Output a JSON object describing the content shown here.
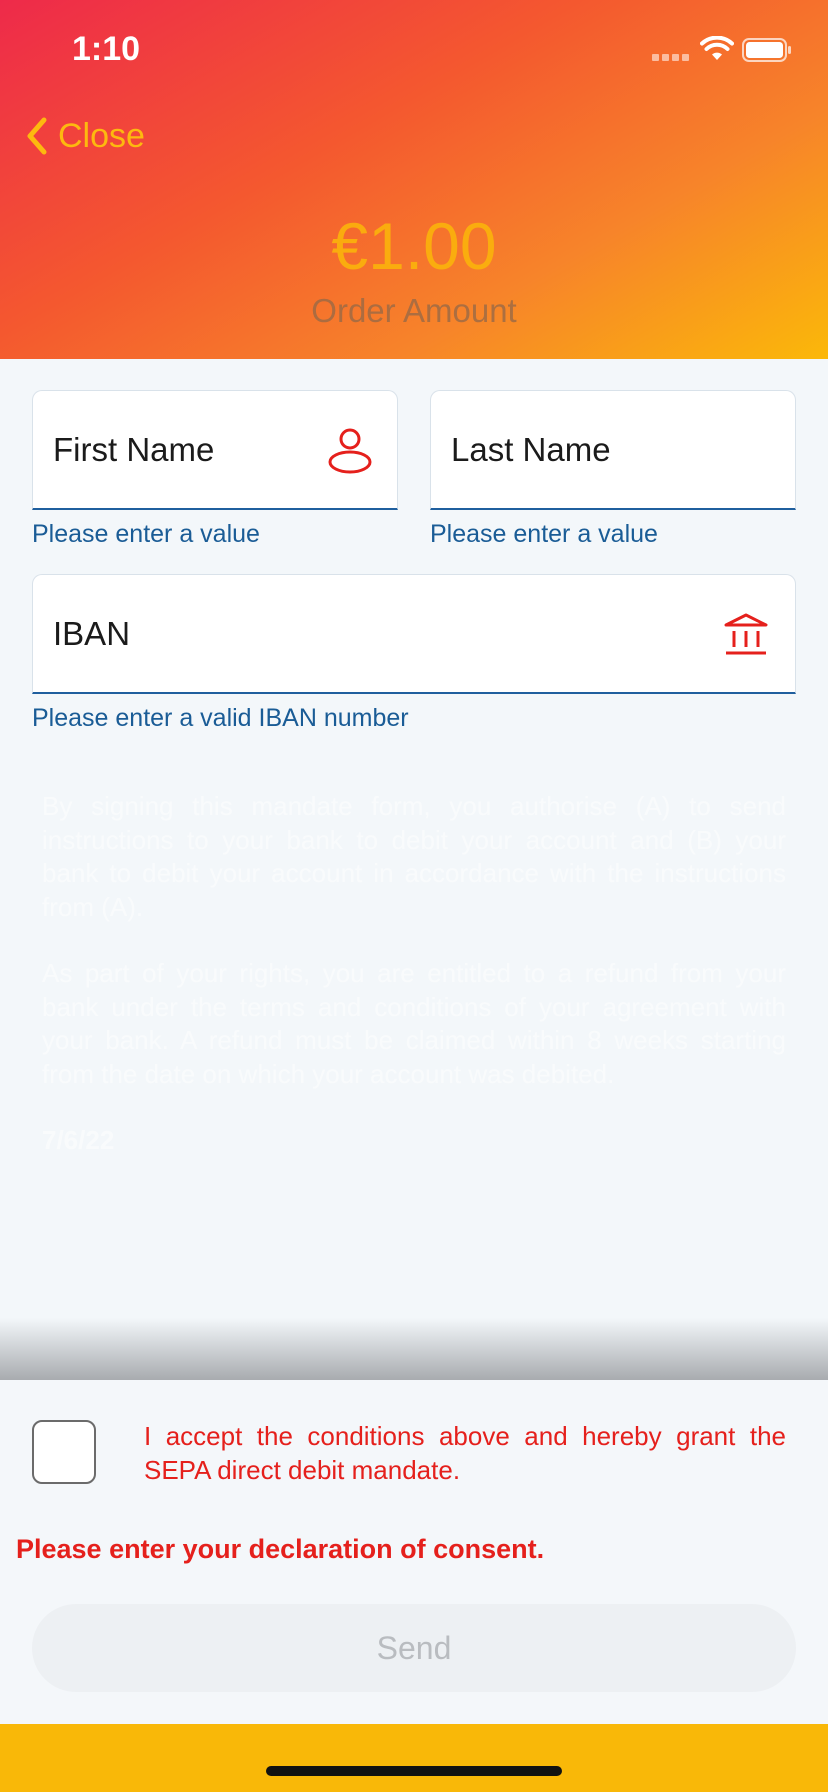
{
  "status_bar": {
    "time": "1:10"
  },
  "nav": {
    "close_label": "Close"
  },
  "order": {
    "amount": "€1.00",
    "label": "Order Amount"
  },
  "form": {
    "first_name": {
      "placeholder": "First Name",
      "error": "Please enter a value"
    },
    "last_name": {
      "placeholder": "Last Name",
      "error": "Please enter a value"
    },
    "iban": {
      "placeholder": "IBAN",
      "error": "Please enter a valid IBAN number"
    }
  },
  "mandate": {
    "paragraph_1": "By signing this mandate form, you authorise (A) to send instructions to your bank to debit your account and (B) your bank to debit your account in accordance with the instructions from (A).",
    "paragraph_2": "As part of your rights, you are entitled to a refund from your bank under the terms and conditions of your agreement with your bank. A refund must be claimed within 8 weeks starting from the date on which your account was debited.",
    "date": "7/6/22"
  },
  "consent": {
    "checkbox_label": "I accept the conditions above and hereby grant the SEPA direct debit mandate.",
    "error": "Please enter your declaration of consent."
  },
  "actions": {
    "send_label": "Send"
  },
  "icons": {
    "close": "chevron-left-icon",
    "first_name": "person-icon",
    "iban": "bank-icon",
    "wifi": "wifi-icon",
    "battery": "battery-icon",
    "signal": "signal-icon"
  },
  "colors": {
    "gradient_start": "#ee2a4a",
    "gradient_end": "#fbb809",
    "accent_yellow": "#fdb90f",
    "error_red": "#e5201c",
    "info_blue": "#1a5c96",
    "field_border": "#1f5f9e"
  }
}
